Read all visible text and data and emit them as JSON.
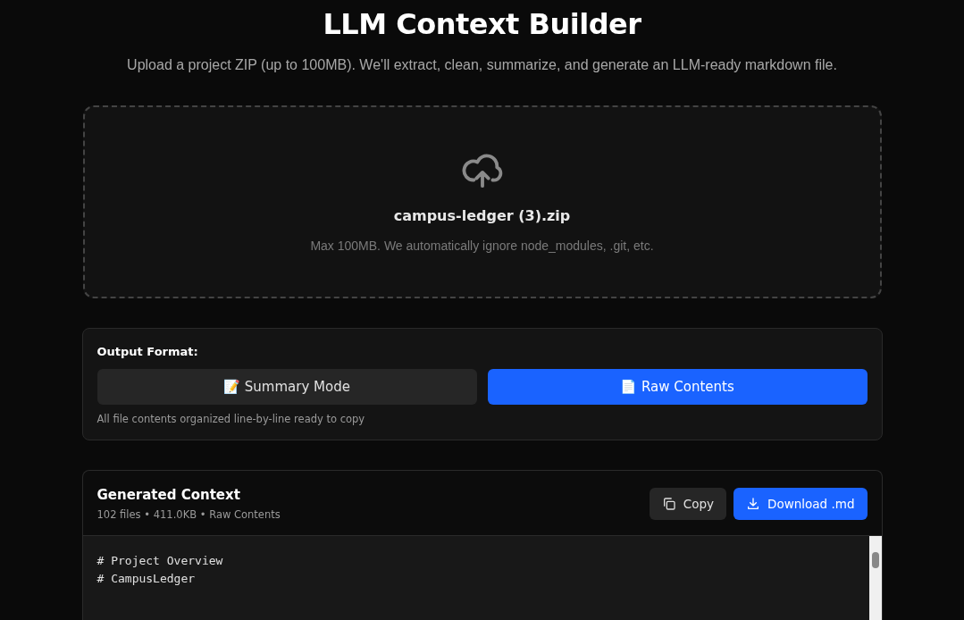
{
  "title": "LLM Context Builder",
  "subtitle": "Upload a project ZIP (up to 100MB). We'll extract, clean, summarize, and generate an LLM-ready markdown file.",
  "dropzone": {
    "filename": "campus-ledger (3).zip",
    "hint": "Max 100MB. We automatically ignore node_modules, .git, etc."
  },
  "output_format": {
    "label": "Output Format:",
    "options": [
      {
        "icon": "📝",
        "label": "Summary Mode",
        "selected": false
      },
      {
        "icon": "📄",
        "label": "Raw Contents",
        "selected": true
      }
    ],
    "description": "All file contents organized line-by-line ready to copy"
  },
  "result": {
    "title": "Generated Context",
    "meta": "102 files • 411.0KB • Raw Contents",
    "copy_label": "Copy",
    "download_label": "Download .md",
    "lines": [
      "# Project Overview",
      "# CampusLedger"
    ]
  }
}
